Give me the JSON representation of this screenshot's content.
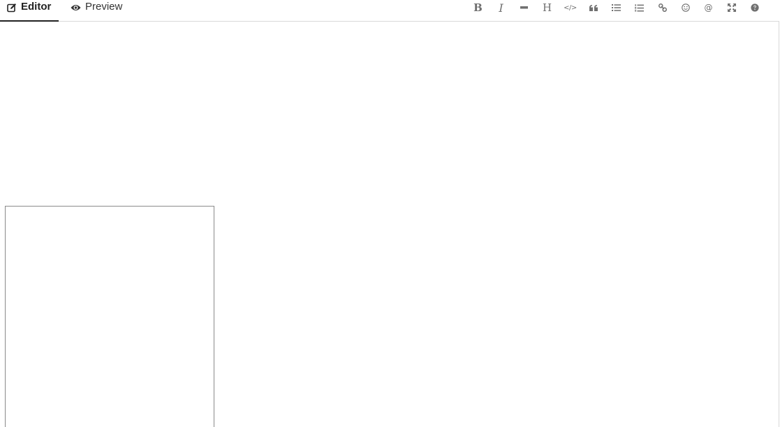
{
  "tabs": {
    "editor": {
      "label": "Editor",
      "icon": "edit-icon",
      "active": true
    },
    "preview": {
      "label": "Preview",
      "icon": "eye-icon",
      "active": false
    }
  },
  "toolbar": {
    "bold": {
      "glyph": "B",
      "icon": "bold-icon"
    },
    "italic": {
      "glyph": "I",
      "icon": "italic-icon"
    },
    "hr": {
      "icon": "horizontal-rule-icon"
    },
    "heading": {
      "glyph": "H",
      "icon": "heading-icon"
    },
    "code": {
      "glyph": "</>",
      "icon": "code-icon"
    },
    "quote": {
      "glyph": "“",
      "icon": "quote-icon"
    },
    "ul": {
      "icon": "unordered-list-icon"
    },
    "ol": {
      "icon": "ordered-list-icon"
    },
    "link": {
      "icon": "link-icon"
    },
    "emoji": {
      "glyph": "☺",
      "icon": "smiley-icon"
    },
    "mention": {
      "glyph": "@",
      "icon": "mention-icon"
    },
    "fullscreen": {
      "icon": "fullscreen-icon"
    },
    "help": {
      "icon": "help-icon"
    }
  },
  "colors": {
    "icon_gray": "#707070",
    "border": "#d9d9d9",
    "active_underline": "#222222",
    "popup_border": "#8a8a8a"
  }
}
